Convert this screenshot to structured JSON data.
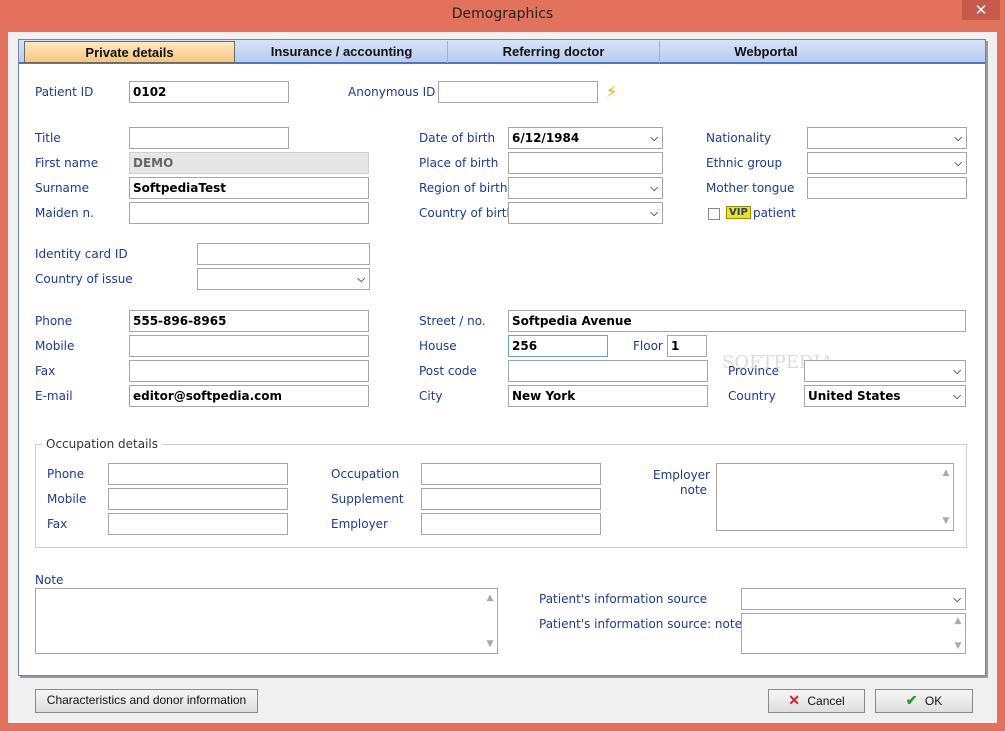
{
  "window": {
    "title": "Demographics",
    "close_glyph": "✕"
  },
  "tabs": [
    "Private details",
    "Insurance / accounting",
    "Referring doctor",
    "Webportal"
  ],
  "ids": {
    "patient_id_label": "Patient ID",
    "patient_id": "0102",
    "anon_id_label": "Anonymous ID",
    "anon_id": ""
  },
  "personal": {
    "title_label": "Title",
    "title": "",
    "first_name_label": "First name",
    "first_name": "DEMO",
    "surname_label": "Surname",
    "surname": "SoftpediaTest",
    "maiden_label": "Maiden n.",
    "maiden": ""
  },
  "birth": {
    "dob_label": "Date of birth",
    "dob": "6/12/1984",
    "place_label": "Place of birth",
    "place": "",
    "region_label": "Region of birth",
    "region": "",
    "country_label": "Country of birth",
    "country": ""
  },
  "culture": {
    "nationality_label": "Nationality",
    "nationality": "",
    "ethnic_label": "Ethnic group",
    "ethnic": "",
    "tongue_label": "Mother tongue",
    "tongue": "",
    "vip_badge": "VIP",
    "vip_label": "patient"
  },
  "identity": {
    "card_label": "Identity card ID",
    "card": "",
    "issue_label": "Country of issue",
    "issue": ""
  },
  "contact": {
    "phone_label": "Phone",
    "phone": "555-896-8965",
    "mobile_label": "Mobile",
    "mobile": "",
    "fax_label": "Fax",
    "fax": "",
    "email_label": "E-mail",
    "email": "editor@softpedia.com"
  },
  "address": {
    "street_label": "Street / no.",
    "street": "Softpedia Avenue",
    "house_label": "House",
    "house": "256",
    "floor_label": "Floor",
    "floor": "1",
    "postcode_label": "Post code",
    "postcode": "",
    "city_label": "City",
    "city": "New York",
    "province_label": "Province",
    "province": "",
    "country_label": "Country",
    "country": "United States"
  },
  "occupation": {
    "group_title": "Occupation details",
    "phone_label": "Phone",
    "mobile_label": "Mobile",
    "fax_label": "Fax",
    "occupation_label": "Occupation",
    "supplement_label": "Supplement",
    "employer_label": "Employer",
    "employer_note_label_1": "Employer",
    "employer_note_label_2": "note"
  },
  "note": {
    "label": "Note",
    "source_label": "Patient's information source",
    "source_note_label": "Patient's information source: note"
  },
  "buttons": {
    "characteristics": "Characteristics and donor information",
    "cancel": "Cancel",
    "ok": "OK"
  },
  "watermark": "SOFTPEDIA"
}
